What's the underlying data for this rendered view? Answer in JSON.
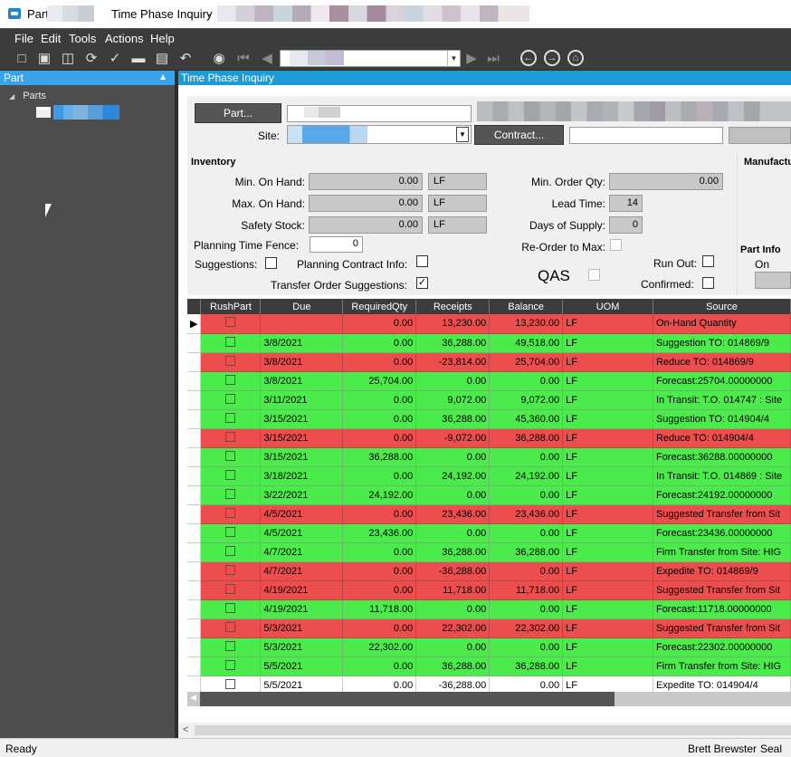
{
  "window": {
    "part_label": "Part",
    "title": "Time Phase Inquiry",
    "title_sep": "-"
  },
  "menu": [
    "File",
    "Edit",
    "Tools",
    "Actions",
    "Help"
  ],
  "left_pane": {
    "title": "Part",
    "tree_root": "Parts"
  },
  "right_pane": {
    "title": "Time Phase Inquiry"
  },
  "form": {
    "part_button": "Part...",
    "site_label": "Site:",
    "contract_button": "Contract...",
    "inventory_title": "Inventory",
    "manufactu_title": "Manufactu",
    "min_on_hand_label": "Min. On Hand:",
    "min_on_hand": "0.00",
    "min_on_hand_uom": "LF",
    "max_on_hand_label": "Max. On Hand:",
    "max_on_hand": "0.00",
    "max_on_hand_uom": "LF",
    "safety_stock_label": "Safety Stock:",
    "safety_stock": "0.00",
    "safety_stock_uom": "LF",
    "planning_time_fence_label": "Planning Time Fence:",
    "planning_time_fence": "0",
    "min_order_qty_label": "Min. Order Qty:",
    "min_order_qty": "0.00",
    "lead_time_label": "Lead Time:",
    "lead_time": "14",
    "days_of_supply_label": "Days of Supply:",
    "days_of_supply": "0",
    "reorder_to_max_label": "Re-Order to Max:",
    "suggestions_label": "Suggestions:",
    "planning_contract_info_label": "Planning Contract Info:",
    "transfer_order_suggestions_label": "Transfer Order Suggestions:",
    "qas_label": "QAS",
    "run_out_label": "Run Out:",
    "confirmed_label": "Confirmed:",
    "part_info_title": "Part Info",
    "on_hold_label": "On Hold"
  },
  "grid": {
    "columns": [
      "RushPart",
      "Due",
      "RequiredQty",
      "Receipts",
      "Balance",
      "UOM",
      "Source"
    ],
    "rows": [
      {
        "c": "r",
        "due": "",
        "req": "0.00",
        "rec": "13,230.00",
        "bal": "13,230.00",
        "uom": "LF",
        "src": "On-Hand Quantity"
      },
      {
        "c": "g",
        "due": "3/8/2021",
        "req": "0.00",
        "rec": "36,288.00",
        "bal": "49,518.00",
        "uom": "LF",
        "src": "Suggestion TO: 014869/9"
      },
      {
        "c": "r",
        "due": "3/8/2021",
        "req": "0.00",
        "rec": "-23,814.00",
        "bal": "25,704.00",
        "uom": "LF",
        "src": "Reduce TO: 014869/9"
      },
      {
        "c": "g",
        "due": "3/8/2021",
        "req": "25,704.00",
        "rec": "0.00",
        "bal": "0.00",
        "uom": "LF",
        "src": "Forecast:25704.00000000"
      },
      {
        "c": "g",
        "due": "3/11/2021",
        "req": "0.00",
        "rec": "9,072.00",
        "bal": "9,072.00",
        "uom": "LF",
        "src": "In Transit: T.O. 014747 : Site"
      },
      {
        "c": "g",
        "due": "3/15/2021",
        "req": "0.00",
        "rec": "36,288.00",
        "bal": "45,360.00",
        "uom": "LF",
        "src": "Suggestion TO: 014904/4"
      },
      {
        "c": "r",
        "due": "3/15/2021",
        "req": "0.00",
        "rec": "-9,072.00",
        "bal": "36,288.00",
        "uom": "LF",
        "src": "Reduce TO: 014904/4"
      },
      {
        "c": "g",
        "due": "3/15/2021",
        "req": "36,288.00",
        "rec": "0.00",
        "bal": "0.00",
        "uom": "LF",
        "src": "Forecast:36288.00000000"
      },
      {
        "c": "g",
        "due": "3/18/2021",
        "req": "0.00",
        "rec": "24,192.00",
        "bal": "24,192.00",
        "uom": "LF",
        "src": "In Transit: T.O. 014869 : Site"
      },
      {
        "c": "g",
        "due": "3/22/2021",
        "req": "24,192.00",
        "rec": "0.00",
        "bal": "0.00",
        "uom": "LF",
        "src": "Forecast:24192.00000000"
      },
      {
        "c": "r",
        "due": "4/5/2021",
        "req": "0.00",
        "rec": "23,436.00",
        "bal": "23,436.00",
        "uom": "LF",
        "src": "Suggested Transfer from Sit"
      },
      {
        "c": "g",
        "due": "4/5/2021",
        "req": "23,436.00",
        "rec": "0.00",
        "bal": "0.00",
        "uom": "LF",
        "src": "Forecast:23436.00000000"
      },
      {
        "c": "g",
        "due": "4/7/2021",
        "req": "0.00",
        "rec": "36,288.00",
        "bal": "36,288.00",
        "uom": "LF",
        "src": "Firm Transfer from Site: HIG"
      },
      {
        "c": "r",
        "due": "4/7/2021",
        "req": "0.00",
        "rec": "-36,288.00",
        "bal": "0.00",
        "uom": "LF",
        "src": "Expedite TO: 014869/9"
      },
      {
        "c": "r",
        "due": "4/19/2021",
        "req": "0.00",
        "rec": "11,718.00",
        "bal": "11,718.00",
        "uom": "LF",
        "src": "Suggested Transfer from Sit"
      },
      {
        "c": "g",
        "due": "4/19/2021",
        "req": "11,718.00",
        "rec": "0.00",
        "bal": "0.00",
        "uom": "LF",
        "src": "Forecast:11718.00000000"
      },
      {
        "c": "r",
        "due": "5/3/2021",
        "req": "0.00",
        "rec": "22,302.00",
        "bal": "22,302.00",
        "uom": "LF",
        "src": "Suggested Transfer from Sit"
      },
      {
        "c": "g",
        "due": "5/3/2021",
        "req": "22,302.00",
        "rec": "0.00",
        "bal": "0.00",
        "uom": "LF",
        "src": "Forecast:22302.00000000"
      },
      {
        "c": "g",
        "due": "5/5/2021",
        "req": "0.00",
        "rec": "36,288.00",
        "bal": "36,288.00",
        "uom": "LF",
        "src": "Firm Transfer from Site: HIG"
      },
      {
        "c": "w",
        "due": "5/5/2021",
        "req": "0.00",
        "rec": "-36,288.00",
        "bal": "0.00",
        "uom": "LF",
        "src": "Expedite TO: 014904/4"
      }
    ]
  },
  "status": {
    "left": "Ready",
    "user": "Brett Brewster",
    "extra": "Seal &"
  }
}
